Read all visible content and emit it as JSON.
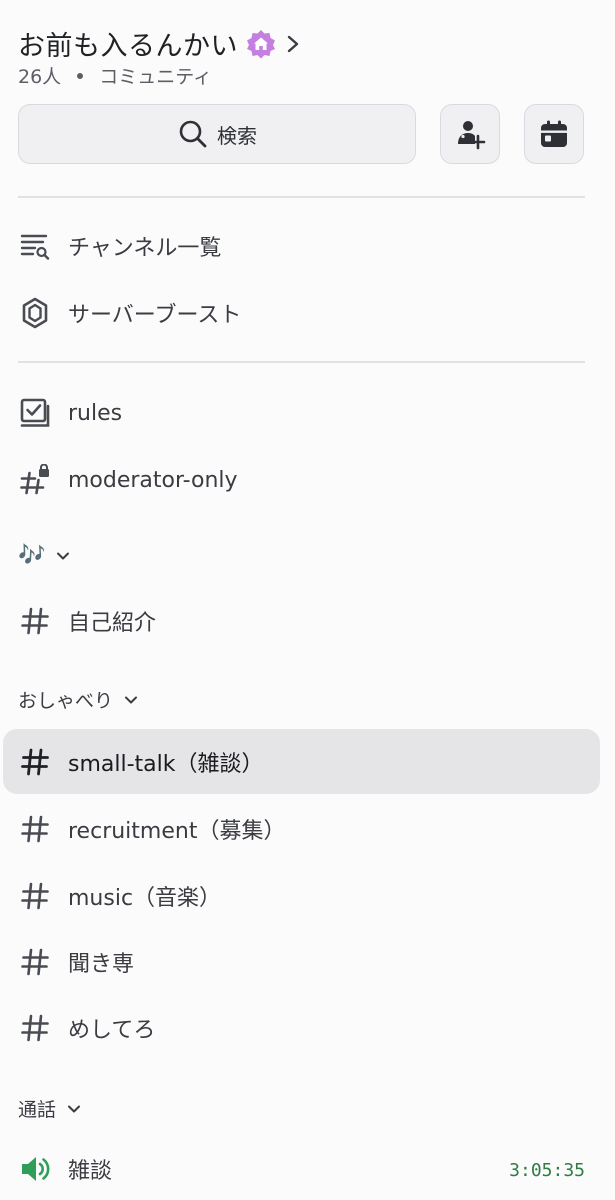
{
  "server": {
    "name": "お前も入るんかい",
    "member_count": "26人",
    "type": "コミュニティ"
  },
  "toolbar": {
    "search_label": "検索"
  },
  "menu": {
    "channel_list": "チャンネル一覧",
    "server_boost": "サーバーブースト"
  },
  "channels_top": [
    {
      "name": "rules"
    },
    {
      "name": "moderator-only"
    }
  ],
  "categories": [
    {
      "label": "🎶",
      "channels": [
        "自己紹介"
      ]
    },
    {
      "label": "おしゃべり",
      "channels": [
        "small-talk（雑談）",
        "recruitment（募集）",
        "music（音楽）",
        "聞き専",
        "めしてろ"
      ]
    },
    {
      "label": "通話",
      "voice": [
        {
          "name": "雑談",
          "timer": "3:05:35"
        }
      ]
    }
  ],
  "colors": {
    "accent_purple": "#c47fe0",
    "voice_green": "#2f7d44",
    "selected_bg": "#e5e5e8"
  }
}
